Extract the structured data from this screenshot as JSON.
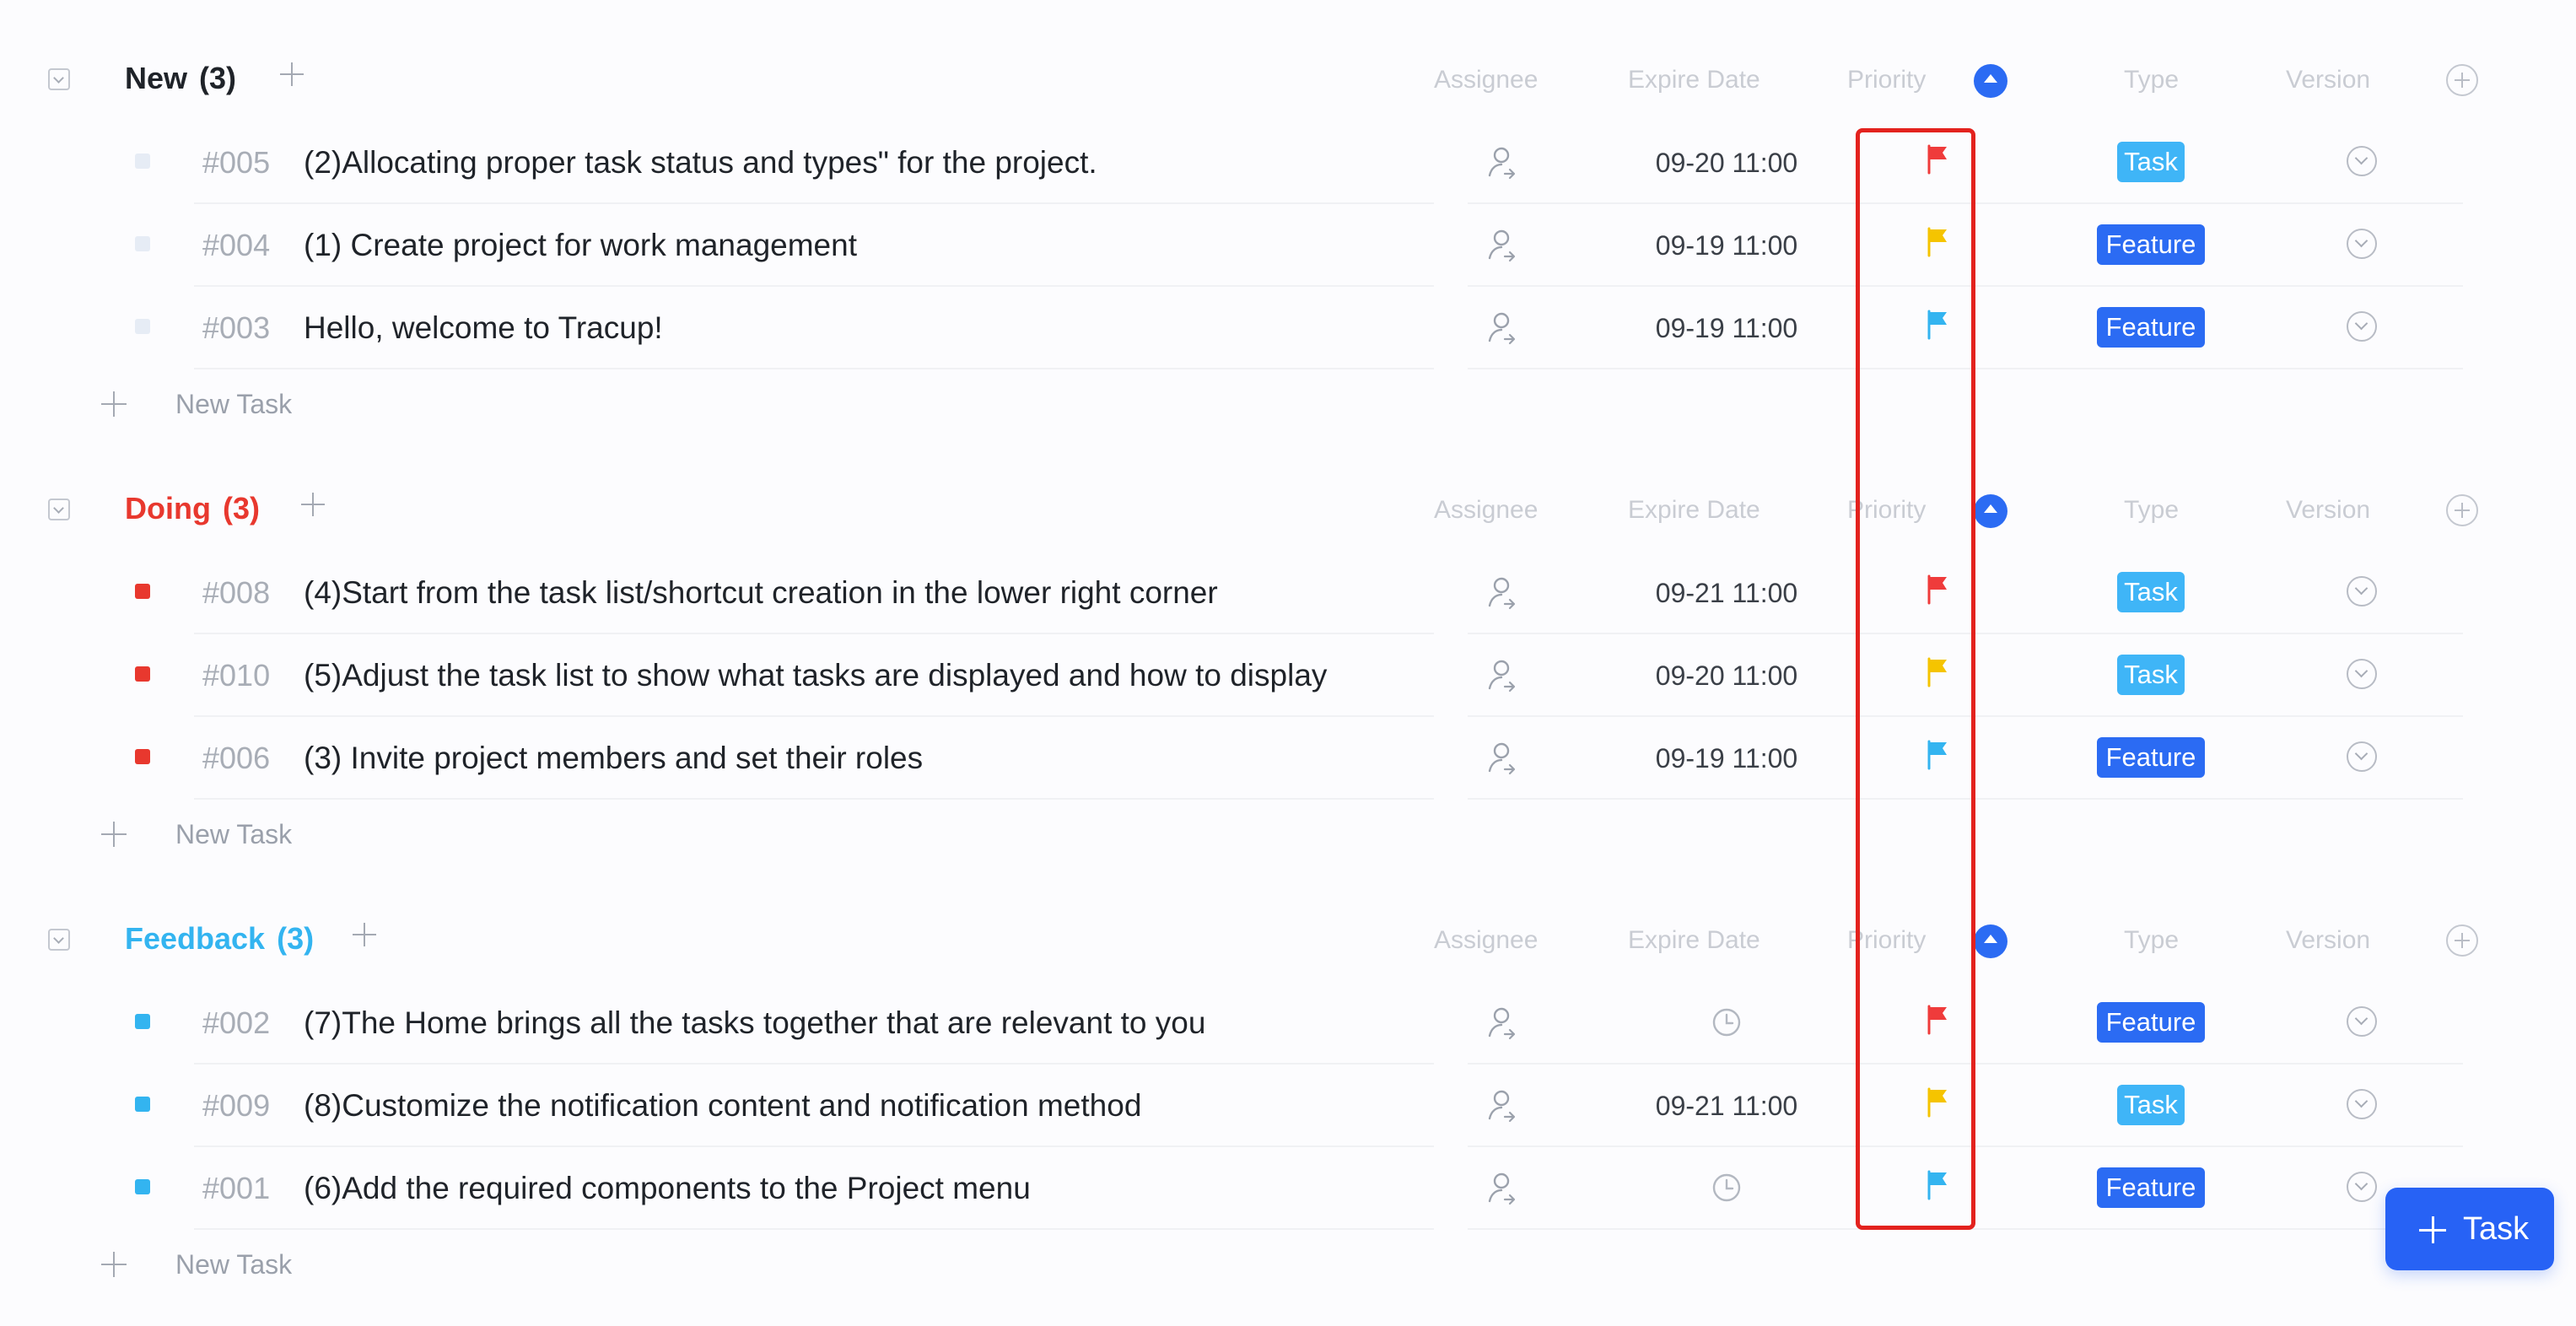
{
  "columns": {
    "assignee": "Assignee",
    "expire_date": "Expire Date",
    "priority": "Priority",
    "type": "Type",
    "version": "Version"
  },
  "new_task_label": "New Task",
  "fab": {
    "label": "Task"
  },
  "colors": {
    "new": "#1f2329",
    "doing": "#e8382e",
    "feedback": "#33b4f0",
    "priority_high": "#ef3b3b",
    "priority_medium": "#f5c400",
    "priority_low": "#33b4f0",
    "type_task": "#3fb5f7",
    "type_feature": "#2b6bf3",
    "highlight": "#e3221e"
  },
  "groups": [
    {
      "name": "New",
      "count": "(3)",
      "tasks": [
        {
          "id": "#005",
          "title": "(2)Allocating proper  task status and types\" for the project.",
          "due": "09-20 11:00",
          "priority": "high",
          "type": "Task"
        },
        {
          "id": "#004",
          "title": "(1) Create project for work management",
          "due": "09-19 11:00",
          "priority": "medium",
          "type": "Feature"
        },
        {
          "id": "#003",
          "title": "Hello, welcome to Tracup!",
          "due": "09-19 11:00",
          "priority": "low",
          "type": "Feature"
        }
      ]
    },
    {
      "name": "Doing",
      "count": "(3)",
      "tasks": [
        {
          "id": "#008",
          "title": "(4)Start from the task list/shortcut creation in the lower right corner",
          "due": "09-21 11:00",
          "priority": "high",
          "type": "Task"
        },
        {
          "id": "#010",
          "title": "(5)Adjust the task list to show what tasks are displayed and how to display",
          "due": "09-20 11:00",
          "priority": "medium",
          "type": "Task"
        },
        {
          "id": "#006",
          "title": "(3) Invite project members and set their roles",
          "due": "09-19 11:00",
          "priority": "low",
          "type": "Feature"
        }
      ]
    },
    {
      "name": "Feedback",
      "count": "(3)",
      "tasks": [
        {
          "id": "#002",
          "title": "(7)The Home brings all the tasks together that are relevant to you",
          "due": "",
          "priority": "high",
          "type": "Feature"
        },
        {
          "id": "#009",
          "title": "(8)Customize the notification content and notification method",
          "due": "09-21 11:00",
          "priority": "medium",
          "type": "Task"
        },
        {
          "id": "#001",
          "title": "(6)Add the required components to the Project menu",
          "due": "",
          "priority": "low",
          "type": "Feature"
        }
      ]
    }
  ]
}
